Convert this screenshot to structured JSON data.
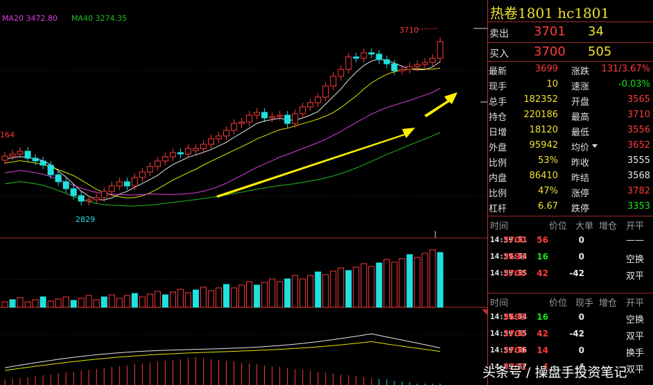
{
  "chart": {
    "ma20_label": "MA20 3472.80",
    "ma40_label": "MA40 3274.35",
    "high_marker": "3710",
    "left_marker": "164",
    "low_marker": "2829",
    "colors": {
      "up": "#ff3c3c",
      "down": "#20e0e0",
      "ma5": "#e8e8e8",
      "ma10": "#e6e600",
      "ma20": "#e040e0",
      "ma40": "#20c020",
      "arrow": "#ffee00"
    }
  },
  "quote": {
    "title": "热卷1801  hc1801",
    "ask_label": "卖出",
    "ask_price": "3701",
    "ask_vol": "34",
    "bid_label": "买入",
    "bid_price": "3700",
    "bid_vol": "505",
    "rows": [
      {
        "l1": "最新",
        "v1": "3699",
        "c1": "red",
        "l2": "涨跌",
        "v2": "131/3.67%",
        "c2": "red"
      },
      {
        "l1": "现手",
        "v1": "10",
        "c1": "yel",
        "l2": "速涨",
        "v2": "-0.03%",
        "c2": "grn"
      },
      {
        "l1": "总手",
        "v1": "182352",
        "c1": "yel",
        "l2": "开盘",
        "v2": "3565",
        "c2": "red"
      },
      {
        "l1": "持仓",
        "v1": "220186",
        "c1": "yel",
        "l2": "最高",
        "v2": "3710",
        "c2": "red"
      },
      {
        "l1": "日增",
        "v1": "18120",
        "c1": "yel",
        "l2": "最低",
        "v2": "3556",
        "c2": "red"
      },
      {
        "l1": "外盘",
        "v1": "95942",
        "c1": "yel",
        "l2": "均价",
        "v2": "3652",
        "c2": "red"
      },
      {
        "l1": "比例",
        "v1": "53%",
        "c1": "yel",
        "l2": "昨收",
        "v2": "3555",
        "c2": "wht"
      },
      {
        "l1": "内盘",
        "v1": "86410",
        "c1": "yel",
        "l2": "昨结",
        "v2": "3568",
        "c2": "wht"
      },
      {
        "l1": "比例",
        "v1": "47%",
        "c1": "yel",
        "l2": "涨停",
        "v2": "3782",
        "c2": "red"
      },
      {
        "l1": "杠杆",
        "v1": "6.67",
        "c1": "yel",
        "l2": "跌停",
        "v2": "3353",
        "c2": "grn"
      }
    ]
  },
  "ticks1": {
    "headers": [
      "时间",
      "价位",
      "大单",
      "增仓",
      "开平"
    ],
    "rows": [
      {
        "time": "14:59:51",
        "price": "3700",
        "vol": "56",
        "inc": "0",
        "type": "——",
        "tc": "wht"
      },
      {
        "time": "14:59:54",
        "price": "3699",
        "vol": "16",
        "inc": "0",
        "type": "空换",
        "tc": "wht"
      },
      {
        "time": "14:59:55",
        "price": "3700",
        "vol": "42",
        "inc": "-42",
        "type": "双平",
        "tc": "wht"
      }
    ]
  },
  "ticks2": {
    "headers": [
      "时间",
      "价位",
      "现手",
      "增仓",
      "开平"
    ],
    "rows": [
      {
        "time": "14:59:54",
        "price": "3699",
        "vol": "16",
        "inc": "0",
        "type": "空换",
        "tc": "wht"
      },
      {
        "time": "14:59:55",
        "price": "3700",
        "vol": "42",
        "inc": "-42",
        "type": "双平",
        "tc": "wht"
      },
      {
        "time": "14:59:56",
        "price": "3700",
        "vol": "14",
        "inc": "0",
        "type": "换手",
        "tc": "wht"
      },
      {
        "time": "14:59:57",
        "price": "3701",
        "vol": "4",
        "inc": "-4",
        "type": "双平",
        "tc": "wht"
      }
    ]
  },
  "watermark": "头条号 / 操盘手投资笔记"
}
